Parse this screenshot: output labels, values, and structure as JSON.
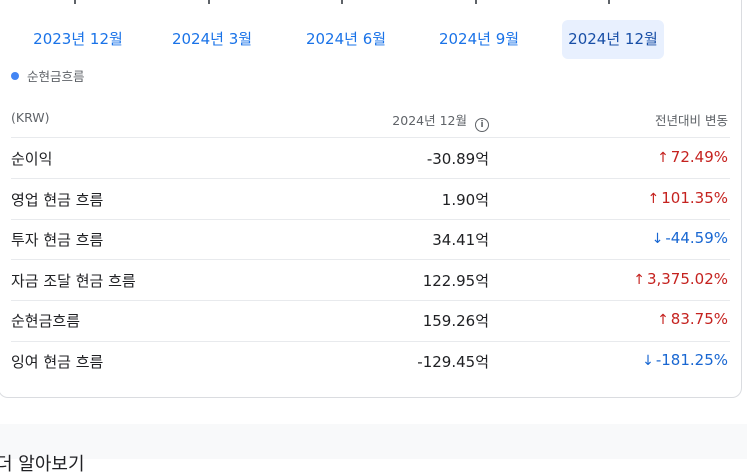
{
  "timeline": {
    "periods": [
      "2023년 12월",
      "2024년 3월",
      "2024년 6월",
      "2024년 9월",
      "2024년 12월"
    ],
    "selected_index": 4
  },
  "legend": {
    "label": "순현금흐름",
    "color": "#4285f4"
  },
  "table": {
    "header": {
      "unit": "(KRW)",
      "period": "2024년 12월",
      "change": "전년대비 변동"
    },
    "rows": [
      {
        "label": "순이익",
        "value": "-30.89억",
        "change": "72.49%",
        "direction": "up"
      },
      {
        "label": "영업 현금 흐름",
        "value": "1.90억",
        "change": "101.35%",
        "direction": "up"
      },
      {
        "label": "투자 현금 흐름",
        "value": "34.41억",
        "change": "-44.59%",
        "direction": "down"
      },
      {
        "label": "자금 조달 현금 흐름",
        "value": "122.95억",
        "change": "3,375.02%",
        "direction": "up"
      },
      {
        "label": "순현금흐름",
        "value": "159.26억",
        "change": "83.75%",
        "direction": "up"
      },
      {
        "label": "잉여 현금 흐름",
        "value": "-129.45억",
        "change": "-181.25%",
        "direction": "down"
      }
    ]
  },
  "icons": {
    "info": "info-icon",
    "up": "arrow-up-icon",
    "down": "arrow-down-icon"
  },
  "colors": {
    "up": "#c5221f",
    "down": "#1967d2",
    "accent": "#1a73e8"
  },
  "next_section": {
    "title": "더 알아보기"
  }
}
